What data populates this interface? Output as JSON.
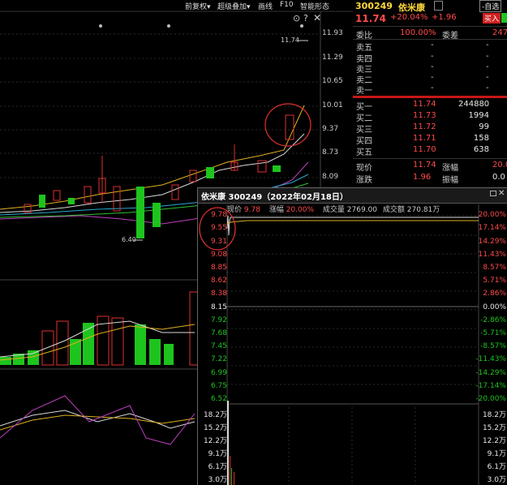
{
  "toolbar": {
    "items": [
      "前复权▾",
      "超级叠加▾",
      "画线",
      "F10",
      "智能形态"
    ],
    "icons": [
      "settings-icon",
      "help-icon",
      "close-icon"
    ]
  },
  "main_chart": {
    "price_axis": [
      "11.93",
      "11.29",
      "10.65",
      "10.01",
      "9.37",
      "8.73",
      "8.09"
    ],
    "high_marker": "11.74",
    "low_marker": "6.40",
    "circle_color": "#e03030"
  },
  "quote": {
    "code": "300249",
    "name": "依米康",
    "price": "11.74",
    "change_pct": "+20.04%",
    "change": "+1.96",
    "buy_button": "买入",
    "watch_button": "-自选",
    "ratio_label": "委比",
    "ratio_value": "100.00%",
    "diff_label": "委差",
    "diff_value": "247",
    "asks": [
      {
        "label": "卖五",
        "price": "-",
        "vol": "-"
      },
      {
        "label": "卖四",
        "price": "-",
        "vol": "-"
      },
      {
        "label": "卖三",
        "price": "-",
        "vol": "-"
      },
      {
        "label": "卖二",
        "price": "-",
        "vol": "-"
      },
      {
        "label": "卖一",
        "price": "-",
        "vol": "-"
      }
    ],
    "bids": [
      {
        "label": "买一",
        "price": "11.74",
        "vol": "244880"
      },
      {
        "label": "买二",
        "price": "11.73",
        "vol": "1994"
      },
      {
        "label": "买三",
        "price": "11.72",
        "vol": "99"
      },
      {
        "label": "买四",
        "price": "11.71",
        "vol": "158"
      },
      {
        "label": "买五",
        "price": "11.70",
        "vol": "638"
      }
    ],
    "stats": [
      {
        "l1": "现价",
        "v1": "11.74",
        "l2": "涨幅",
        "v2": "20.0"
      },
      {
        "l1": "涨跌",
        "v1": "1.96",
        "l2": "振幅",
        "v2": "0.0"
      }
    ]
  },
  "popup": {
    "title": "依米康 300249（2022年02月18日）",
    "info_price_label": "现价",
    "info_price": "9.78",
    "info_change_label": "涨幅",
    "info_change": "20.00%",
    "info_vol_label": "成交量",
    "info_vol": "2769.00",
    "info_amount_label": "成交额",
    "info_amount": "270.81万",
    "price_levels": [
      "9.78",
      "9.55",
      "9.31",
      "9.08",
      "8.85",
      "8.62",
      "8.38",
      "8.15",
      "7.92",
      "7.68",
      "7.45",
      "7.22",
      "6.99",
      "6.75",
      "6.52"
    ],
    "pct_levels": [
      "20.00%",
      "17.14%",
      "14.29%",
      "11.43%",
      "8.57%",
      "5.71%",
      "2.86%",
      "0.00%",
      "-2.86%",
      "-5.71%",
      "-8.57%",
      "-11.43%",
      "-14.29%",
      "-17.14%",
      "-20.00%"
    ],
    "vol_levels": [
      "18.2万",
      "15.2万",
      "12.2万",
      "9.1万",
      "6.1万",
      "3.0万"
    ]
  }
}
